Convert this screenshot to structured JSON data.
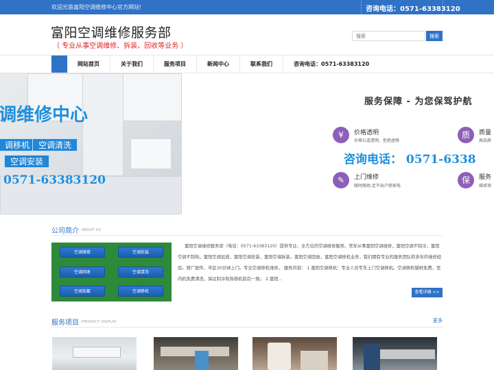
{
  "topbar": {
    "welcome": "欢迎光临富阳空调维修中心官方网站!",
    "phone": "咨询电话：0571-63383120"
  },
  "header": {
    "title": "富阳空调维修服务部",
    "subtitle": "（ 专业从事空调维修、拆装、回收等业务 ）"
  },
  "search": {
    "placeholder": "搜索",
    "button": "搜索"
  },
  "nav": {
    "items": [
      "网站首页",
      "关于我们",
      "服务项目",
      "新闻中心",
      "联系我们",
      "咨询电话：0571-63383120"
    ]
  },
  "banner": {
    "left_title": "调维修中心",
    "tags": [
      "调移机",
      "空调清洗",
      "空调安装"
    ],
    "left_phone": "0571-63383120",
    "service_title": "服务保障 - 为您保驾护航",
    "features": [
      {
        "icon": "¥",
        "title": "价格透明",
        "desc": "价格公道透明、拒绝虚假"
      },
      {
        "icon": "质",
        "title": "质量",
        "desc": "高品质"
      },
      {
        "icon": "✎",
        "title": "上门维修",
        "desc": "随时随地,足不出户修家电"
      },
      {
        "icon": "保",
        "title": "服务",
        "desc": "维修项"
      }
    ],
    "consult": "咨询电话： 0571-6338"
  },
  "company": {
    "title": "公司简介",
    "subtitle": "ABOUT US",
    "image_buttons": [
      "空调维修",
      "空调拆装",
      "空调回收",
      "空调清洗",
      "空调加氟",
      "空调移机"
    ],
    "text": "富阳空调维修服务部（电话：0571-63383120）提供专业、全方位的空调维修服务。常年从事富阳空调维修，富阳空调不制冷，富阳空调不制热，富阳空调加液，富阳空调安装，富阳空调拆装，富阳空调回收，富阳空调移机业务，我们拥有专业的服务团队和多年的维修经验。原厂配件、市区30分钟上门。专业空调移机维修。  服务内容：    1.富阳空调移机：专业人员专车上门空调移机。空调移机辅材免费，室内机免费清洗，保证制冷制热移机前后一致。   2.富阳...",
    "more": "查看详细 >>"
  },
  "services": {
    "title": "服务项目",
    "subtitle": "PRODUCT DISPLAY",
    "more": "更多"
  }
}
